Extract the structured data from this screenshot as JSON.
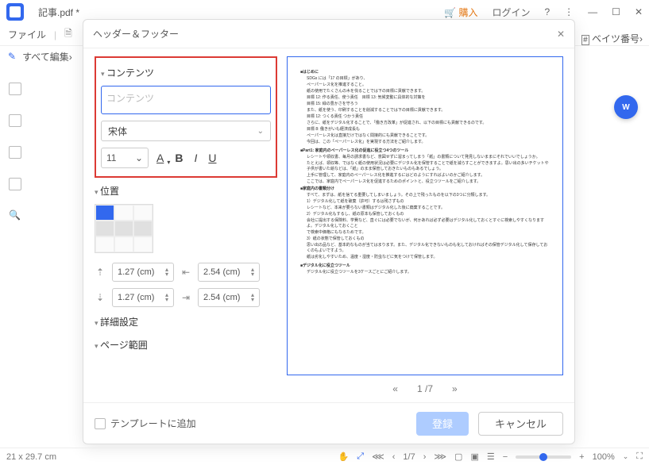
{
  "titlebar": {
    "filename": "記事.pdf *",
    "buy": "購入",
    "login": "ログイン"
  },
  "toolbar": {
    "file": "ファイル",
    "bates": "ベイツ番号›"
  },
  "editbar": {
    "all_edit": "すべて編集›"
  },
  "statusbar": {
    "size": "21 x 29.7 cm",
    "page": "1/7",
    "zoom": "100%"
  },
  "dialog": {
    "title": "ヘッダー＆フッター",
    "sections": {
      "contents": "コンテンツ",
      "position": "位置",
      "advanced": "詳細設定",
      "pagerange": "ページ範囲"
    },
    "content_placeholder": "コンテンツ",
    "font": "宋体",
    "fontsize": "11",
    "margins": {
      "top": "1.27 (cm)",
      "bottom": "1.27 (cm)",
      "left": "2.54 (cm)",
      "right": "2.54 (cm)"
    },
    "footer": {
      "template": "テンプレートに追加",
      "apply": "登録",
      "cancel": "キャンセル"
    },
    "preview_page": "1 /7"
  },
  "preview_text": {
    "h1": "■はじめに",
    "l1": "SDGs には「17 の目標」があり、",
    "l2": "ペーパーレス化を推進すること。",
    "l3": "紙の使用でたくさんの木を伐ることでは下の目標に貢献できます。",
    "l4": "目標 12: 作る責任、使う責任　目標 13: 気候変動に具体的な対策を",
    "l5": "目標 15: 緑の豊かさを守ろう",
    "l6": "また、紙を使う、印刷することを削減することでは下の目標に貢献できます。",
    "l7": "目標 12: つくる責任 つかう責任",
    "l8": "さらに、紙をデジタル化することで、「働き方改革」が促進され、以下の目標にも貢献できるのです。",
    "l9": "目標 8: 働きがいも経済成長も",
    "l10": "ペーパーレス化は直接だけではなく間接的にも貢献できることです。",
    "l11": "今回は、この「ペーパーレス化」を実現する方法をご紹介します。",
    "h2": "■Part1: 家庭内のペーパーレス化の促進に役立つ4つのツール",
    "l12": "レシートや領収書、毎月の請求書など、意図せずに溜まってしまう「紙」の書類について発見しないままにそれでいいでしょうか。",
    "l13": "たとえば、領収等、ではなく紙の使用状況は必要にデジタル化を保管することで紙を減らすことができますよ。思い出の多いチケットや子供が書いた絵などは、「紙」のまま保管しておきたいものもあるでしょう。",
    "l14": "上手に管理して、家庭内のペーパーレス化を推進するにはどのようにすればよいのかご紹介します。",
    "l15": "ここでは、家庭内でペーパーレス化を促進するためのポイントと、役立つツールをご紹介します。",
    "h3": "■家庭内の書類分け",
    "l16": "すべて、まずは、紙を捨てる重要してしまいましょう。その上で残ったものを以下の3つに分類します。",
    "l17": "1）デジタル化して紙を破棄（許可）するは残さずもの",
    "l18": "レシートなど、本来が要らない書類はデジタル化した後に廃棄することです。",
    "l19": "2）デジタル化もするし、紙の原本も保管しておくもの",
    "l20": "会社に提出する保険料、学費など、直ぐには必要でないが、何かあれば必ず必要はデジタル化しておくとすぐに検索しやすくなりますよ。デジタル化しておくこと",
    "l21": "で検索中価格にもなるためです。",
    "l22": "3）紙の状態で保管しておくもの",
    "l23": "思い出の品など、基本的なものが当てはまります。また、デジタル化できないものも化しておければその保管デジタル化して保存しておくのもよいですよう。",
    "l24": "紙は劣化しやすいため、温度・湿度・防虫などに気をつけて保管します。",
    "h4": "■デジタル化に役立つツール",
    "l25": "デジタル化に役立つツールを3ケースごとにご紹介します。"
  }
}
